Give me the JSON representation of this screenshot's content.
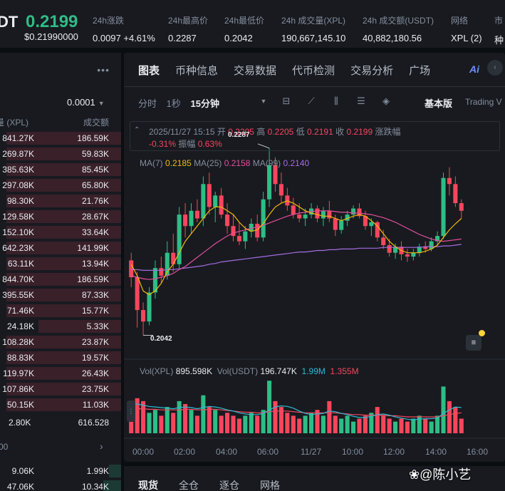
{
  "ticker": {
    "symbol": "DT",
    "price": "0.2199",
    "price_usd": "$0.21990000",
    "stats": [
      {
        "label": "24h涨跌",
        "value": "0.0097 +4.61%",
        "tone": "up"
      },
      {
        "label": "24h最高价",
        "value": "0.2287",
        "tone": ""
      },
      {
        "label": "24h最低价",
        "value": "0.2042",
        "tone": ""
      },
      {
        "label": "24h 成交量(XPL)",
        "value": "190,667,145.10",
        "tone": ""
      },
      {
        "label": "24h 成交额(USDT)",
        "value": "40,882,180.56",
        "tone": ""
      },
      {
        "label": "网络",
        "value": "XPL (2)",
        "tone": ""
      },
      {
        "label": "市",
        "value": "种",
        "tone": "yel"
      }
    ]
  },
  "order_book": {
    "menu_icon": "more-dots-icon",
    "precision": "0.0001",
    "col_qty": "量 (XPL)",
    "col_total": "成交额",
    "asks": [
      {
        "qty": "841.27K",
        "total": "186.59K",
        "depth": 0.95
      },
      {
        "qty": "269.87K",
        "total": "59.83K",
        "depth": 0.95
      },
      {
        "qty": "385.63K",
        "total": "85.45K",
        "depth": 0.95
      },
      {
        "qty": "297.08K",
        "total": "65.80K",
        "depth": 0.95
      },
      {
        "qty": "98.30K",
        "total": "21.76K",
        "depth": 0.95
      },
      {
        "qty": "129.58K",
        "total": "28.67K",
        "depth": 0.95
      },
      {
        "qty": "152.10K",
        "total": "33.64K",
        "depth": 0.95
      },
      {
        "qty": "642.23K",
        "total": "141.99K",
        "depth": 0.95
      },
      {
        "qty": "63.11K",
        "total": "13.94K",
        "depth": 0.95
      },
      {
        "qty": "844.70K",
        "total": "186.59K",
        "depth": 0.95
      },
      {
        "qty": "395.55K",
        "total": "87.33K",
        "depth": 0.95
      },
      {
        "qty": "71.46K",
        "total": "15.77K",
        "depth": 0.95
      },
      {
        "qty": "24.18K",
        "total": "5.33K",
        "depth": 0.68
      },
      {
        "qty": "108.28K",
        "total": "23.87K",
        "depth": 0.95
      },
      {
        "qty": "88.83K",
        "total": "19.57K",
        "depth": 0.95
      },
      {
        "qty": "119.97K",
        "total": "26.43K",
        "depth": 0.95
      },
      {
        "qty": "107.86K",
        "total": "23.75K",
        "depth": 0.95
      },
      {
        "qty": "50.15K",
        "total": "11.03K",
        "depth": 0.95
      }
    ],
    "last_qty": "2.80K",
    "last_total": "616.528",
    "mid_label": "00",
    "bids": [
      {
        "qty": "9.06K",
        "total": "1.99K",
        "depth": 0.1
      },
      {
        "qty": "47.06K",
        "total": "10.34K",
        "depth": 0.15
      }
    ]
  },
  "chart_panel": {
    "tabs": [
      "图表",
      "币种信息",
      "交易数据",
      "代币检测",
      "交易分析",
      "广场"
    ],
    "active_tab": 0,
    "toolbar": {
      "time_label": "分时",
      "sec_label": "1秒",
      "interval": "15分钟",
      "version": "基本版",
      "tradingview": "Trading V"
    },
    "icons": [
      "dropdown-caret-icon",
      "indicator-icon",
      "draw-line-icon",
      "candle-type-icon",
      "settings-icon",
      "layers-icon"
    ],
    "ohlc": {
      "datetime": "2025/11/27 15:15",
      "open_lbl": "开",
      "open": "0.2205",
      "high_lbl": "高",
      "high": "0.2205",
      "low_lbl": "低",
      "low": "0.2191",
      "close_lbl": "收",
      "close": "0.2199",
      "chg_lbl": "涨跌幅",
      "chg": "-0.31%",
      "amp_lbl": "振幅",
      "amp": "0.63%"
    },
    "ma": {
      "ma7_lbl": "MA(7)",
      "ma7": "0.2185",
      "ma25_lbl": "MA(25)",
      "ma25": "0.2158",
      "ma99_lbl": "MA(99)",
      "ma99": "0.2140"
    },
    "vol": {
      "xpl_lbl": "Vol(XPL)",
      "xpl": "895.598K",
      "usdt_lbl": "Vol(USDT)",
      "usdt": "196.747K",
      "v1": "1.99M",
      "v2": "1.355M"
    },
    "high_marker": "0.2287",
    "low_marker": "0.2042",
    "x_axis": [
      "00:00",
      "02:00",
      "04:00",
      "06:00",
      "11/27",
      "10:00",
      "12:00",
      "14:00",
      "16:00"
    ]
  },
  "chart_data": {
    "type": "candlestick",
    "interval": "15分钟",
    "y_range": [
      0.202,
      0.23
    ],
    "candles": [
      {
        "o": 0.214,
        "h": 0.215,
        "l": 0.2105,
        "c": 0.2118
      },
      {
        "o": 0.2118,
        "h": 0.2125,
        "l": 0.2052,
        "c": 0.2075
      },
      {
        "o": 0.2075,
        "h": 0.2085,
        "l": 0.2042,
        "c": 0.206
      },
      {
        "o": 0.206,
        "h": 0.2105,
        "l": 0.2055,
        "c": 0.2098
      },
      {
        "o": 0.2098,
        "h": 0.214,
        "l": 0.209,
        "c": 0.213
      },
      {
        "o": 0.213,
        "h": 0.2145,
        "l": 0.211,
        "c": 0.212
      },
      {
        "o": 0.212,
        "h": 0.2165,
        "l": 0.2115,
        "c": 0.215
      },
      {
        "o": 0.215,
        "h": 0.2175,
        "l": 0.2125,
        "c": 0.2135
      },
      {
        "o": 0.2135,
        "h": 0.221,
        "l": 0.213,
        "c": 0.22
      },
      {
        "o": 0.22,
        "h": 0.2215,
        "l": 0.217,
        "c": 0.2185
      },
      {
        "o": 0.2185,
        "h": 0.2215,
        "l": 0.2175,
        "c": 0.2205
      },
      {
        "o": 0.2205,
        "h": 0.222,
        "l": 0.219,
        "c": 0.2195
      },
      {
        "o": 0.2195,
        "h": 0.225,
        "l": 0.2185,
        "c": 0.224
      },
      {
        "o": 0.224,
        "h": 0.2255,
        "l": 0.22,
        "c": 0.221
      },
      {
        "o": 0.221,
        "h": 0.223,
        "l": 0.219,
        "c": 0.2225
      },
      {
        "o": 0.2225,
        "h": 0.2235,
        "l": 0.2195,
        "c": 0.22
      },
      {
        "o": 0.22,
        "h": 0.2215,
        "l": 0.2175,
        "c": 0.2185
      },
      {
        "o": 0.2185,
        "h": 0.22,
        "l": 0.2165,
        "c": 0.2172
      },
      {
        "o": 0.2172,
        "h": 0.219,
        "l": 0.216,
        "c": 0.2165
      },
      {
        "o": 0.2165,
        "h": 0.2185,
        "l": 0.2155,
        "c": 0.2178
      },
      {
        "o": 0.2178,
        "h": 0.2195,
        "l": 0.217,
        "c": 0.2188
      },
      {
        "o": 0.2188,
        "h": 0.22,
        "l": 0.2165,
        "c": 0.217
      },
      {
        "o": 0.217,
        "h": 0.223,
        "l": 0.2165,
        "c": 0.222
      },
      {
        "o": 0.222,
        "h": 0.2287,
        "l": 0.221,
        "c": 0.2265
      },
      {
        "o": 0.2265,
        "h": 0.2275,
        "l": 0.223,
        "c": 0.224
      },
      {
        "o": 0.224,
        "h": 0.2255,
        "l": 0.2215,
        "c": 0.2225
      },
      {
        "o": 0.2225,
        "h": 0.2235,
        "l": 0.2205,
        "c": 0.2212
      },
      {
        "o": 0.2212,
        "h": 0.2222,
        "l": 0.2195,
        "c": 0.22
      },
      {
        "o": 0.22,
        "h": 0.2215,
        "l": 0.219,
        "c": 0.2195
      },
      {
        "o": 0.2195,
        "h": 0.2208,
        "l": 0.2185,
        "c": 0.22
      },
      {
        "o": 0.22,
        "h": 0.2215,
        "l": 0.2195,
        "c": 0.2208
      },
      {
        "o": 0.2208,
        "h": 0.2212,
        "l": 0.219,
        "c": 0.2195
      },
      {
        "o": 0.2195,
        "h": 0.221,
        "l": 0.2185,
        "c": 0.2205
      },
      {
        "o": 0.2205,
        "h": 0.2218,
        "l": 0.219,
        "c": 0.2195
      },
      {
        "o": 0.2195,
        "h": 0.22,
        "l": 0.2172,
        "c": 0.218
      },
      {
        "o": 0.218,
        "h": 0.2198,
        "l": 0.2175,
        "c": 0.2192
      },
      {
        "o": 0.2192,
        "h": 0.2205,
        "l": 0.2185,
        "c": 0.22
      },
      {
        "o": 0.22,
        "h": 0.2212,
        "l": 0.2195,
        "c": 0.2208
      },
      {
        "o": 0.2208,
        "h": 0.2215,
        "l": 0.2195,
        "c": 0.2198
      },
      {
        "o": 0.2198,
        "h": 0.2205,
        "l": 0.218,
        "c": 0.2185
      },
      {
        "o": 0.2185,
        "h": 0.2195,
        "l": 0.2172,
        "c": 0.219
      },
      {
        "o": 0.219,
        "h": 0.2192,
        "l": 0.2165,
        "c": 0.217
      },
      {
        "o": 0.217,
        "h": 0.218,
        "l": 0.2155,
        "c": 0.216
      },
      {
        "o": 0.216,
        "h": 0.2168,
        "l": 0.2145,
        "c": 0.215
      },
      {
        "o": 0.215,
        "h": 0.2162,
        "l": 0.2142,
        "c": 0.2158
      },
      {
        "o": 0.2158,
        "h": 0.2165,
        "l": 0.214,
        "c": 0.2148
      },
      {
        "o": 0.2148,
        "h": 0.2155,
        "l": 0.2138,
        "c": 0.2145
      },
      {
        "o": 0.2145,
        "h": 0.2155,
        "l": 0.214,
        "c": 0.215
      },
      {
        "o": 0.215,
        "h": 0.2162,
        "l": 0.2145,
        "c": 0.2158
      },
      {
        "o": 0.2158,
        "h": 0.2165,
        "l": 0.215,
        "c": 0.2155
      },
      {
        "o": 0.2155,
        "h": 0.217,
        "l": 0.2152,
        "c": 0.2165
      },
      {
        "o": 0.2165,
        "h": 0.2178,
        "l": 0.216,
        "c": 0.2172
      },
      {
        "o": 0.2172,
        "h": 0.2255,
        "l": 0.2168,
        "c": 0.2248
      },
      {
        "o": 0.2248,
        "h": 0.2262,
        "l": 0.2225,
        "c": 0.224
      },
      {
        "o": 0.224,
        "h": 0.225,
        "l": 0.221,
        "c": 0.2215
      },
      {
        "o": 0.2215,
        "h": 0.222,
        "l": 0.2195,
        "c": 0.2205
      }
    ],
    "ma7": [
      0.2135,
      0.212,
      0.21,
      0.2095,
      0.21,
      0.211,
      0.2125,
      0.2135,
      0.215,
      0.2165,
      0.2175,
      0.2185,
      0.2195,
      0.2205,
      0.221,
      0.221,
      0.2205,
      0.22,
      0.219,
      0.2182,
      0.2178,
      0.218,
      0.2188,
      0.22,
      0.221,
      0.2215,
      0.2218,
      0.2215,
      0.221,
      0.2205,
      0.2202,
      0.22,
      0.2198,
      0.2198,
      0.2195,
      0.2192,
      0.2195,
      0.2198,
      0.22,
      0.2198,
      0.2192,
      0.2185,
      0.2175,
      0.2165,
      0.2158,
      0.2153,
      0.215,
      0.215,
      0.215,
      0.2152,
      0.2155,
      0.216,
      0.217,
      0.218,
      0.2188,
      0.2195
    ],
    "ma25": [
      0.212,
      0.2118,
      0.2116,
      0.2115,
      0.2116,
      0.2118,
      0.212,
      0.2123,
      0.2128,
      0.2132,
      0.2138,
      0.2144,
      0.215,
      0.2156,
      0.2162,
      0.2167,
      0.2172,
      0.2176,
      0.2178,
      0.218,
      0.2182,
      0.2184,
      0.2186,
      0.2189,
      0.2192,
      0.2195,
      0.2198,
      0.22,
      0.2202,
      0.2203,
      0.2204,
      0.2205,
      0.2205,
      0.2205,
      0.2204,
      0.2203,
      0.2203,
      0.2202,
      0.2202,
      0.2201,
      0.22,
      0.2198,
      0.2196,
      0.2193,
      0.219,
      0.2186,
      0.2182,
      0.2178,
      0.2174,
      0.2171,
      0.2168,
      0.2166,
      0.2165,
      0.2166,
      0.2167,
      0.2168
    ],
    "ma99": [
      0.2128,
      0.2128,
      0.2127,
      0.2127,
      0.2127,
      0.2127,
      0.2128,
      0.2128,
      0.2129,
      0.213,
      0.2131,
      0.2132,
      0.2133,
      0.2135,
      0.2136,
      0.2138,
      0.2139,
      0.214,
      0.2141,
      0.2142,
      0.2143,
      0.2144,
      0.2145,
      0.2146,
      0.2147,
      0.2148,
      0.2149,
      0.215,
      0.2151,
      0.2151,
      0.2152,
      0.2153,
      0.2153,
      0.2154,
      0.2154,
      0.2155,
      0.2155,
      0.2155,
      0.2156,
      0.2156,
      0.2156,
      0.2156,
      0.2157,
      0.2157,
      0.2157,
      0.2157,
      0.2157,
      0.2157,
      0.2157,
      0.2158,
      0.2158,
      0.2158,
      0.2159,
      0.2159,
      0.216,
      0.2161
    ],
    "volume": [
      0.45,
      0.6,
      0.55,
      0.35,
      0.4,
      0.3,
      0.45,
      0.35,
      0.55,
      0.5,
      0.4,
      0.3,
      0.65,
      0.45,
      0.4,
      0.3,
      0.35,
      0.3,
      0.25,
      0.3,
      0.35,
      0.3,
      0.4,
      0.9,
      0.55,
      0.45,
      0.35,
      0.3,
      0.25,
      0.3,
      0.35,
      0.4,
      0.3,
      0.55,
      0.3,
      0.25,
      0.3,
      0.2,
      0.25,
      0.3,
      0.35,
      0.45,
      0.3,
      0.25,
      0.2,
      0.25,
      0.2,
      0.25,
      0.3,
      0.25,
      0.2,
      0.3,
      0.8,
      0.55,
      0.45,
      0.25
    ],
    "vol_ma1": [
      0.5,
      0.5,
      0.48,
      0.46,
      0.45,
      0.44,
      0.43,
      0.42,
      0.44,
      0.45,
      0.44,
      0.42,
      0.44,
      0.46,
      0.45,
      0.43,
      0.4,
      0.38,
      0.35,
      0.33,
      0.32,
      0.32,
      0.34,
      0.4,
      0.45,
      0.47,
      0.46,
      0.43,
      0.38,
      0.34,
      0.32,
      0.33,
      0.34,
      0.38,
      0.37,
      0.34,
      0.32,
      0.29,
      0.27,
      0.27,
      0.29,
      0.32,
      0.33,
      0.31,
      0.28,
      0.26,
      0.24,
      0.23,
      0.24,
      0.25,
      0.25,
      0.26,
      0.34,
      0.4,
      0.45,
      0.44
    ],
    "vol_ma2": [
      0.42,
      0.42,
      0.42,
      0.41,
      0.41,
      0.4,
      0.4,
      0.4,
      0.4,
      0.41,
      0.41,
      0.4,
      0.4,
      0.41,
      0.41,
      0.4,
      0.39,
      0.38,
      0.37,
      0.36,
      0.36,
      0.35,
      0.35,
      0.37,
      0.38,
      0.38,
      0.38,
      0.37,
      0.36,
      0.35,
      0.35,
      0.35,
      0.35,
      0.35,
      0.35,
      0.34,
      0.33,
      0.32,
      0.32,
      0.31,
      0.31,
      0.31,
      0.31,
      0.3,
      0.3,
      0.29,
      0.28,
      0.28,
      0.28,
      0.28,
      0.28,
      0.28,
      0.3,
      0.32,
      0.34,
      0.35
    ]
  },
  "trade_tabs": [
    "现货",
    "全仓",
    "逐仓",
    "网格"
  ],
  "active_trade_tab": 0,
  "watermark": "❀@陈小艺"
}
